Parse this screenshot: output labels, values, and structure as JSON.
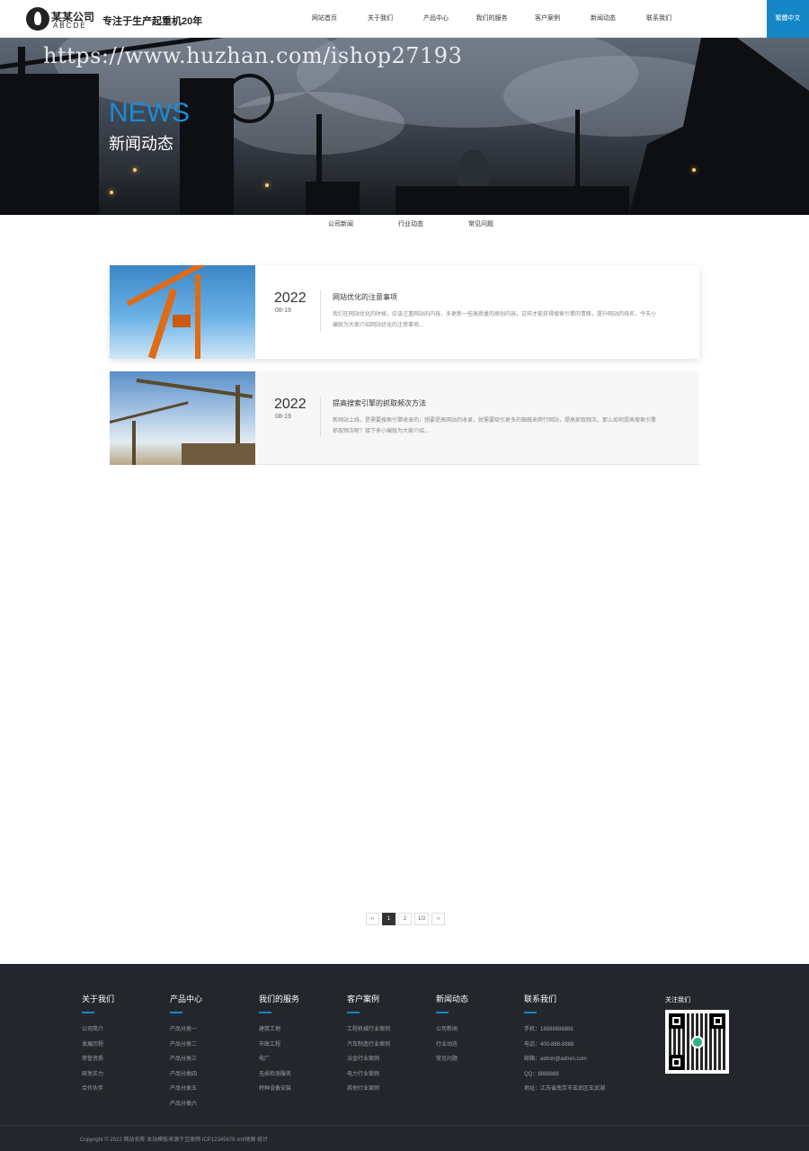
{
  "header": {
    "logo_cn": "某某公司",
    "logo_en": "ABCDE",
    "slogan": "专注于生产起重机20年",
    "nav": [
      "网站首页",
      "关于我们",
      "产品中心",
      "我们的服务",
      "客户案例",
      "新闻动态",
      "联系我们"
    ],
    "lang_button": "繁體中文"
  },
  "banner": {
    "watermark": "https://www.huzhan.com/ishop27193",
    "title_en": "NEWS",
    "title_cn": "新闻动态"
  },
  "subtabs": [
    "公司新闻",
    "行业动态",
    "常见问题"
  ],
  "news": [
    {
      "year": "2022",
      "date": "08-19",
      "title": "网站优化的注意事项",
      "desc": "我们在网站优化的时候，应该注重网站的内容，多更新一些高质量的原创内容，这样才能获得搜索引擎的青睐，提升网站的排名，今天小编就为大家介绍网站优化的注意事项..."
    },
    {
      "year": "2022",
      "date": "08-19",
      "title": "提高搜索引擎的抓取频次方法",
      "desc": "新网站上线，是需要搜索引擎收录的，想要提高网站的收录，就需要吸引更多的蜘蛛来爬行网站，提高抓取频次，那么如何提高搜索引擎抓取频次呢？接下来小编就为大家介绍..."
    }
  ],
  "pagination": [
    "‹‹",
    "1",
    "2",
    "1/2",
    "››"
  ],
  "footer": {
    "columns": [
      {
        "title": "关于我们",
        "links": [
          "公司简介",
          "发展历程",
          "荣誉资质",
          "研发实力",
          "合作伙伴"
        ]
      },
      {
        "title": "产品中心",
        "links": [
          "产品分类一",
          "产品分类二",
          "产品分类三",
          "产品分类四",
          "产品分类五",
          "产品分类六"
        ]
      },
      {
        "title": "我们的服务",
        "links": [
          "建筑工地",
          "市政工程",
          "电厂",
          "无损检测服务",
          "特种设备安装"
        ]
      },
      {
        "title": "客户案例",
        "links": [
          "工程机械行业案例",
          "汽车制造行业案例",
          "冶金行业案例",
          "电力行业案例",
          "其他行业案例"
        ]
      },
      {
        "title": "新闻动态",
        "links": [
          "公司新闻",
          "行业动态",
          "常见问题"
        ]
      },
      {
        "title": "联系我们",
        "links": [
          "手机：18888888888",
          "电话：400-888-8888",
          "邮箱：admin@admin.com",
          "QQ：8888888",
          "地址：江苏省南京市玄武区玄武湖"
        ]
      }
    ],
    "qr_title": "关注我们",
    "copyright": "Copyright © 2022 网站名称 本站模板来源于互联网 ICP12345678 xml地图 统计"
  },
  "colors": {
    "accent": "#1587c6",
    "footer_bg": "#23272b",
    "banner_en": "#1a8cd8"
  }
}
